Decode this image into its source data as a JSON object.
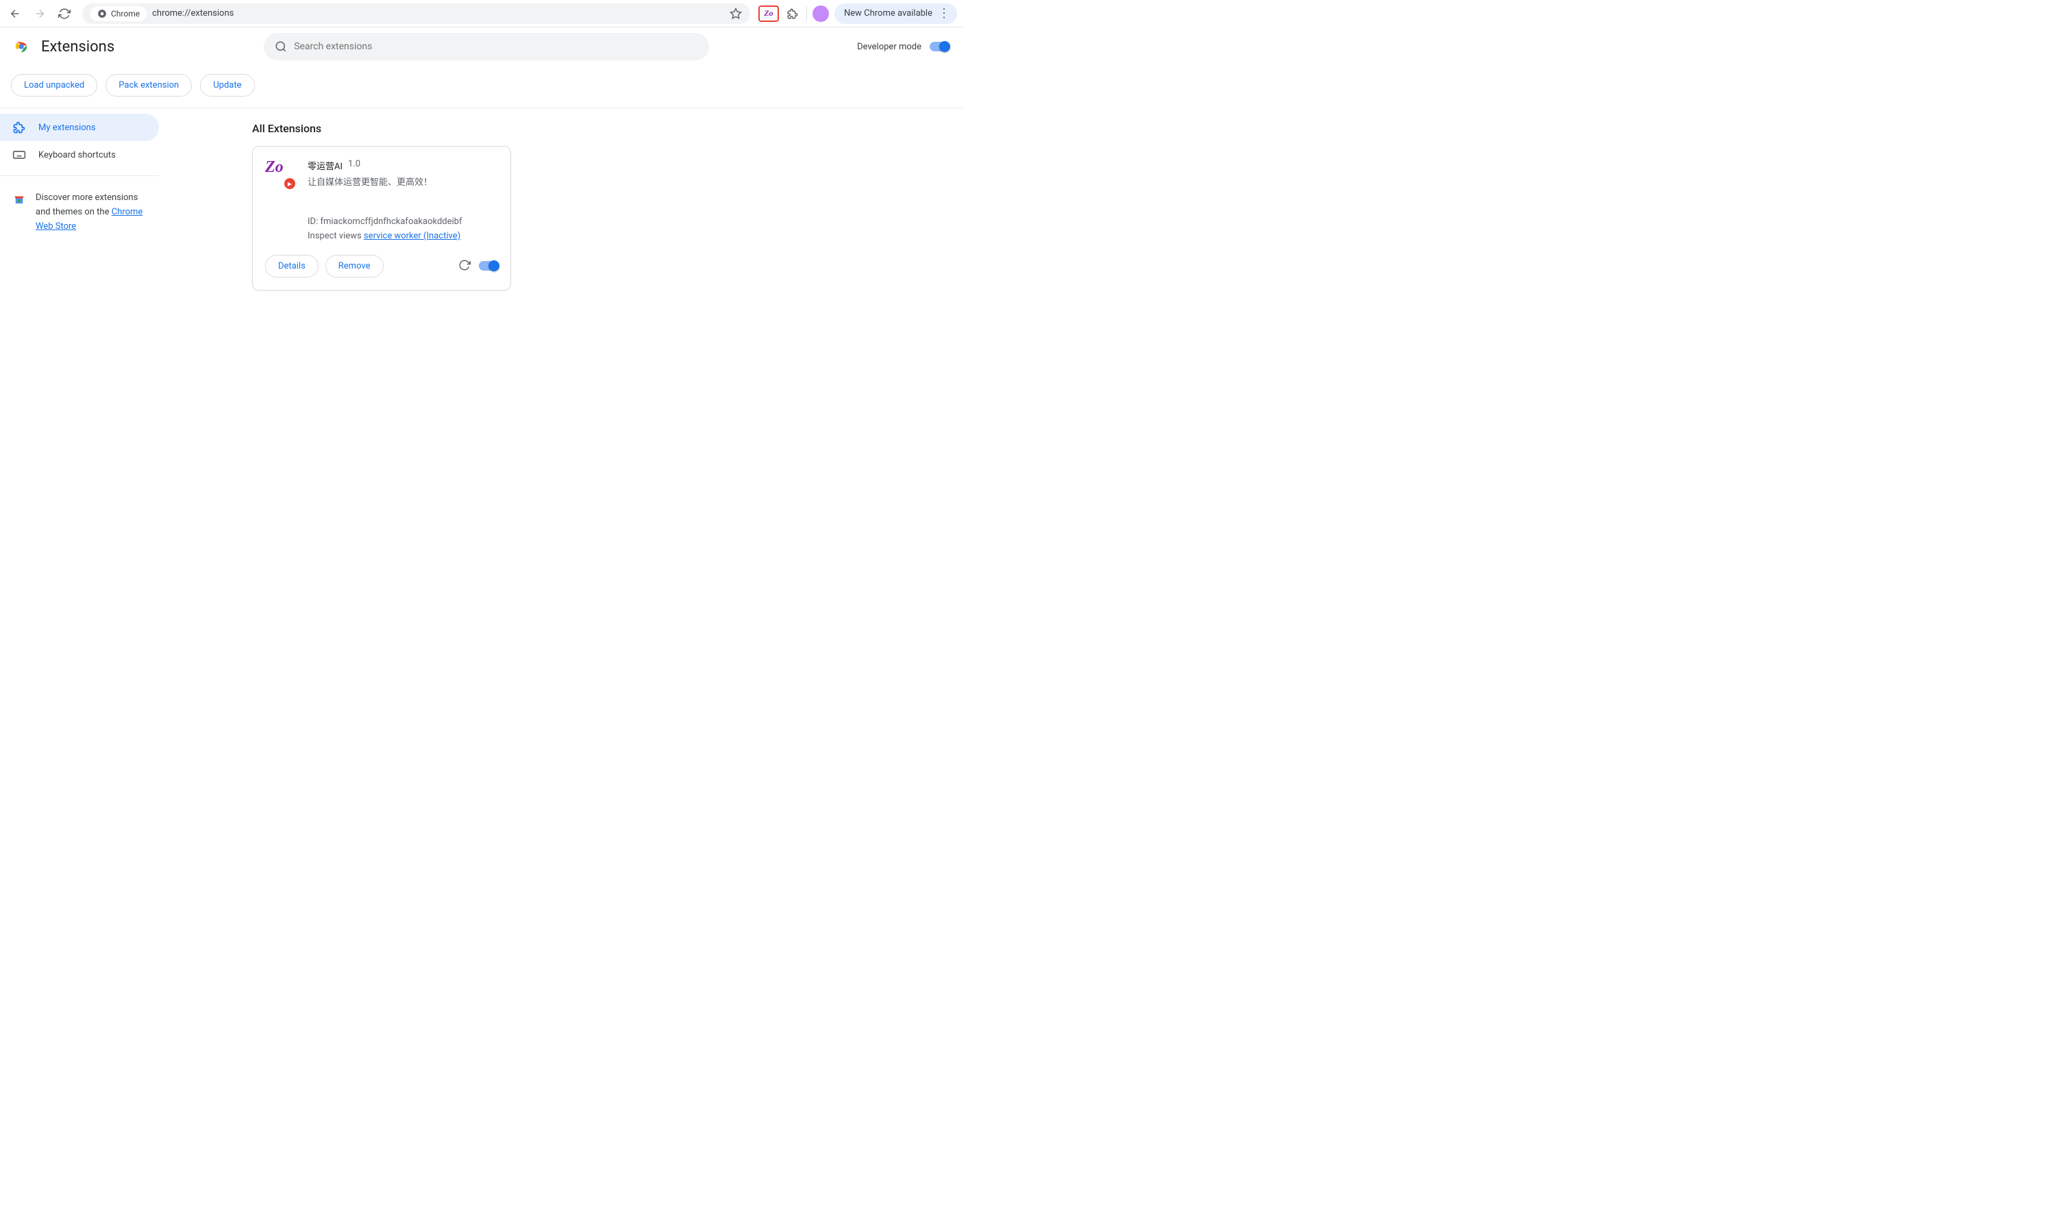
{
  "browser": {
    "address_label": "Chrome",
    "url": "chrome://extensions",
    "update_label": "New Chrome available"
  },
  "header": {
    "title": "Extensions",
    "search_placeholder": "Search extensions",
    "dev_mode_label": "Developer mode"
  },
  "dev_buttons": {
    "load_unpacked": "Load unpacked",
    "pack_extension": "Pack extension",
    "update": "Update"
  },
  "sidebar": {
    "my_extensions": "My extensions",
    "keyboard_shortcuts": "Keyboard shortcuts",
    "discover_text": "Discover more extensions and themes on the ",
    "discover_link": "Chrome Web Store"
  },
  "content": {
    "section_title": "All Extensions"
  },
  "extension": {
    "name": "零运营AI",
    "version": "1.0",
    "description": "让自媒体运营更智能、更高效！",
    "id_label": "ID: ",
    "id": "fmiackomcffjdnfhckafoakaokddeibf",
    "inspect_label": "Inspect views ",
    "inspect_link": "service worker (Inactive)",
    "details_btn": "Details",
    "remove_btn": "Remove"
  }
}
